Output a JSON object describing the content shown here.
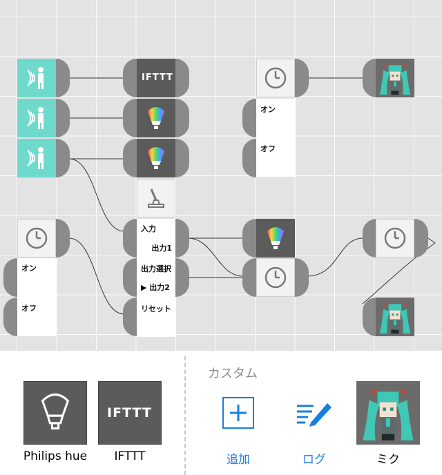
{
  "canvas": {
    "ifttt_text": "IFTTT",
    "timer_block_top": {
      "on_label": "オン",
      "off_label": "オフ"
    },
    "timer_block_left": {
      "on_label": "オン",
      "off_label": "オフ"
    },
    "switch_block": {
      "input_label": "入力",
      "output1_label": "出力1",
      "output_select_label": "出力選択",
      "output2_label": "▶ 出力2",
      "reset_label": "リセット"
    }
  },
  "palette": {
    "section_title": "カスタム",
    "items": [
      {
        "label": "Philips hue",
        "icon": "hue-bulb-icon"
      },
      {
        "label": "IFTTT",
        "icon": "ifttt-logo-icon"
      },
      {
        "label": "追加",
        "icon": "add-plus-icon"
      },
      {
        "label": "ログ",
        "icon": "log-edit-icon"
      },
      {
        "label": "ミク",
        "icon": "miku-character-icon"
      }
    ]
  },
  "colors": {
    "teal": "#6fd9cc",
    "dark_tile": "#5b5b5b",
    "accent_blue": "#1a7ee0"
  }
}
